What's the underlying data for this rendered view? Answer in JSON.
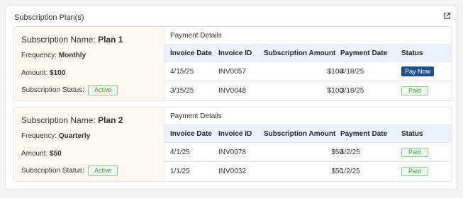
{
  "panel": {
    "title": "Subscription Plan(s)",
    "icon": "external-link-icon"
  },
  "plans": [
    {
      "name_label": "Subscription Name:",
      "name": "Plan 1",
      "frequency_label": "Frequency:",
      "frequency": "Monthly",
      "amount_label": "Amount:",
      "amount": "$100",
      "status_label": "Subscription Status:",
      "status": "Active",
      "payment_title": "Payment Details",
      "columns": [
        "Invoice Date",
        "Invoice ID",
        "Subscription Amount",
        "Payment Date",
        "Status"
      ],
      "rows": [
        {
          "invoice_date": "4/15/25",
          "invoice_id": "INV0057",
          "amount": "$100",
          "payment_date": "4/18/25",
          "status": "Pay Now"
        },
        {
          "invoice_date": "3/15/25",
          "invoice_id": "INV0048",
          "amount": "$100",
          "payment_date": "3/18/25",
          "status": "Paid"
        }
      ]
    },
    {
      "name_label": "Subscription Name:",
      "name": "Plan 2",
      "frequency_label": "Frequency:",
      "frequency": "Quarterly",
      "amount_label": "Amount:",
      "amount": "$50",
      "status_label": "Subscription Status:",
      "status": "Active",
      "payment_title": "Payment Details",
      "columns": [
        "Invoice Date",
        "Invoice ID",
        "Subscription Amount",
        "Payment Date",
        "Status"
      ],
      "rows": [
        {
          "invoice_date": "4/1/25",
          "invoice_id": "INV0078",
          "amount": "$50",
          "payment_date": "4/2/25",
          "status": "Paid"
        },
        {
          "invoice_date": "1/1/25",
          "invoice_id": "INV0032",
          "amount": "$50",
          "payment_date": "1/2/25",
          "status": "Paid"
        }
      ]
    }
  ],
  "colors": {
    "pay_button": "#1f4e8c",
    "badge_green": "#4a9c46",
    "header_bg": "#eaf3fb",
    "plan_bg": "#fdf8f0"
  }
}
